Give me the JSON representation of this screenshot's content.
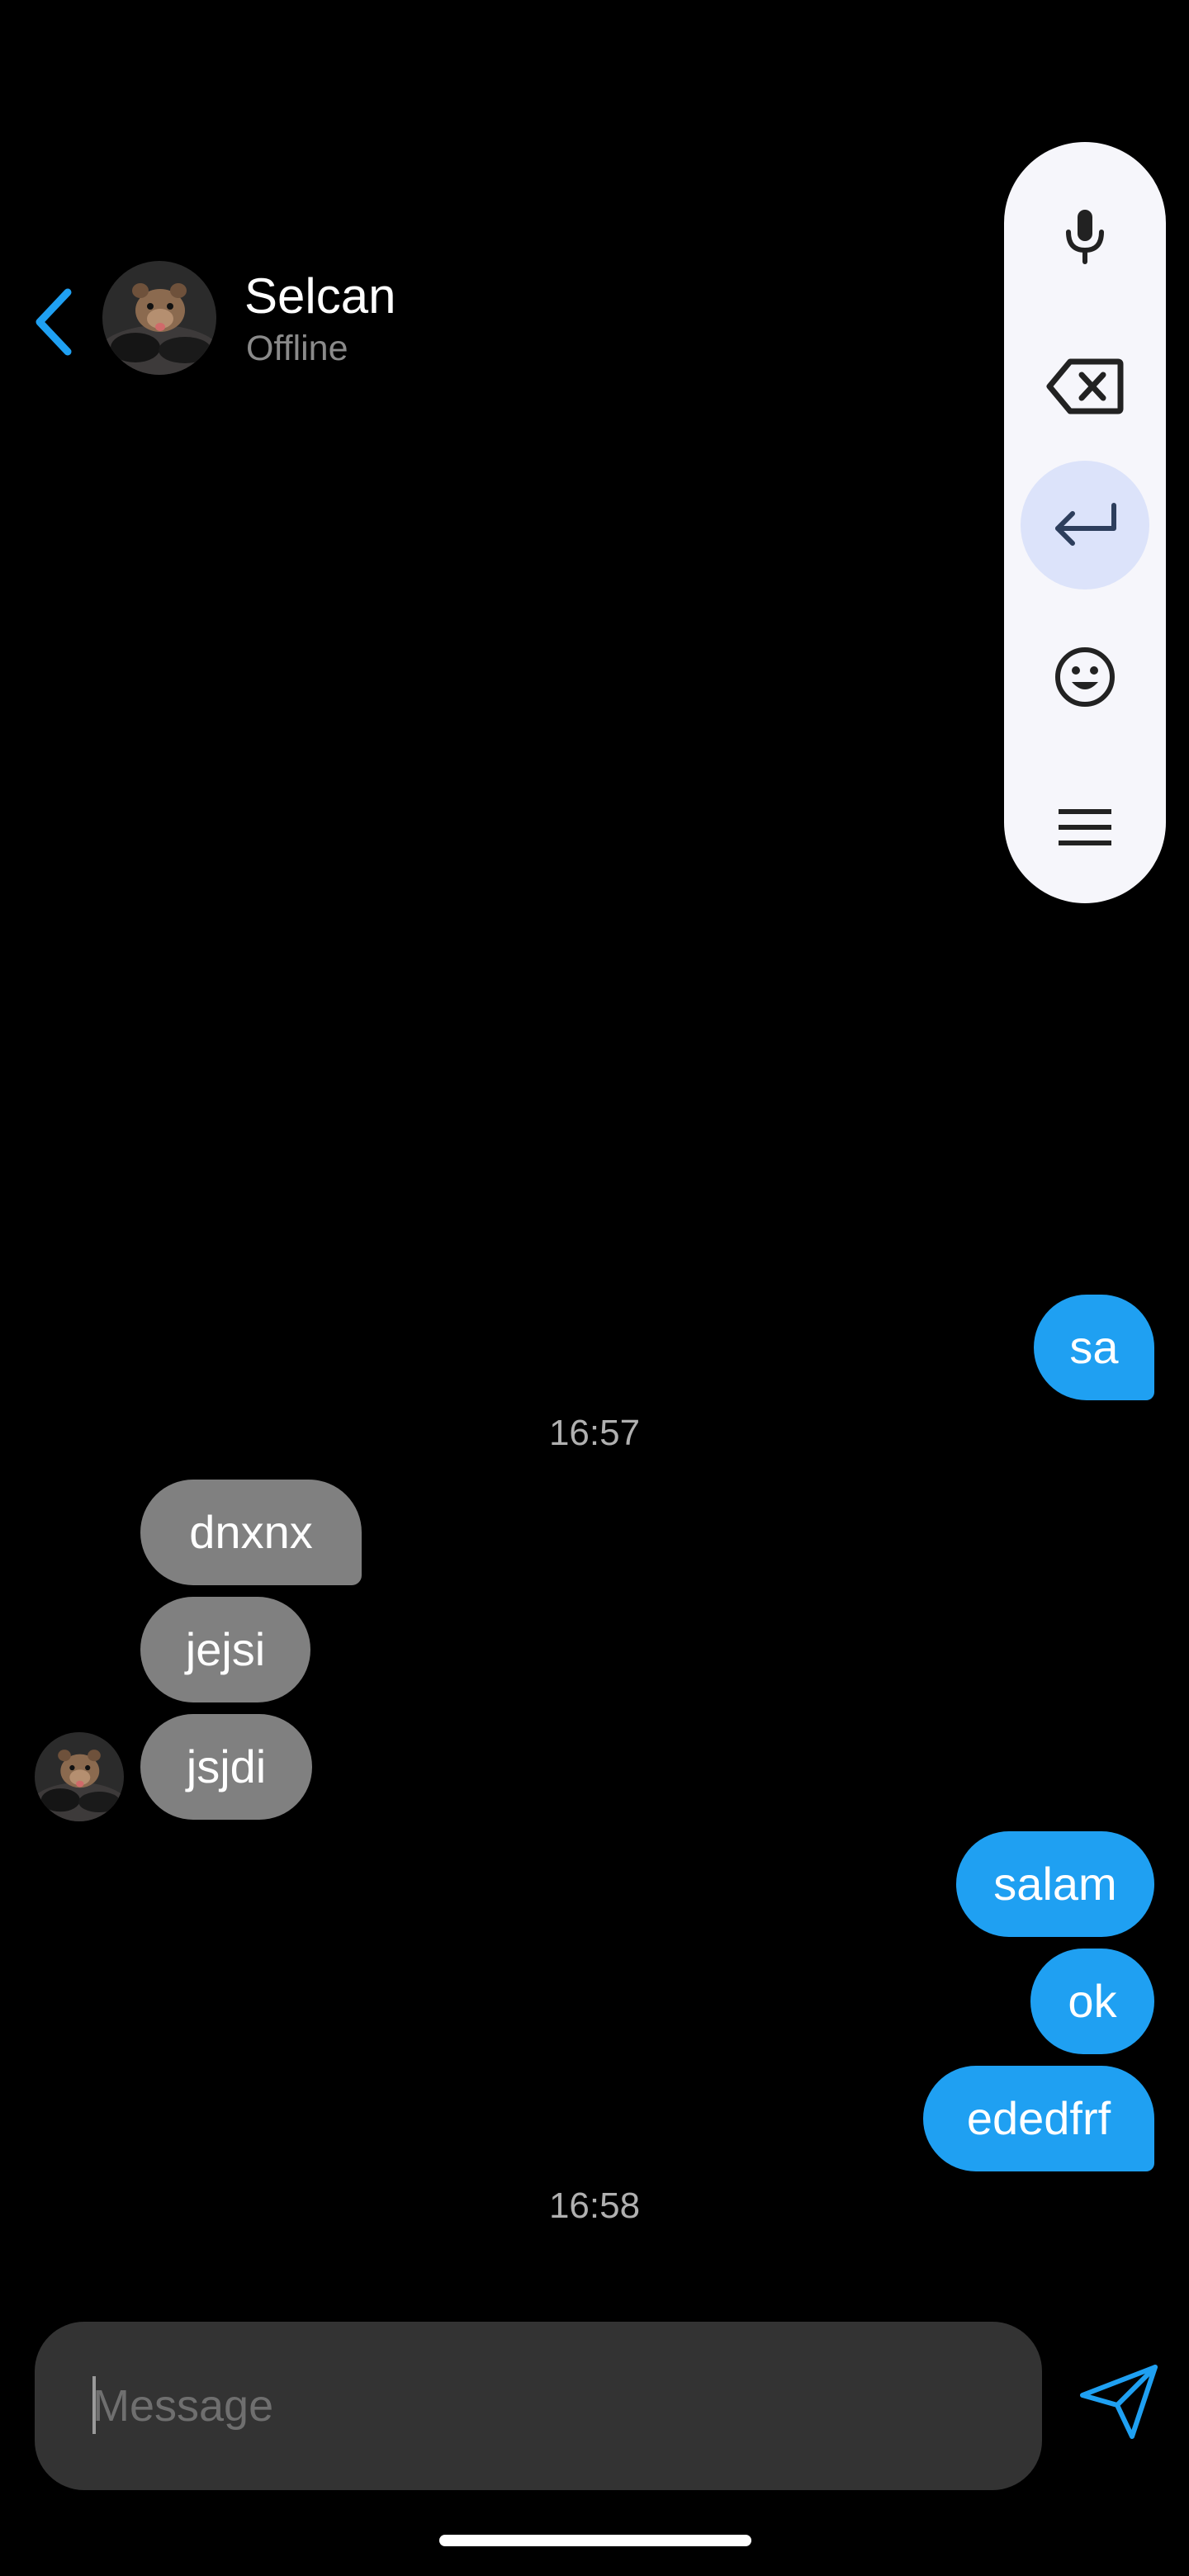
{
  "header": {
    "contact_name": "Selcan",
    "contact_status": "Offline",
    "back_icon": "chevron-left-icon",
    "accent_color": "#1fa0f2"
  },
  "toolbar": {
    "buttons": [
      {
        "icon": "microphone-icon"
      },
      {
        "icon": "backspace-icon"
      },
      {
        "icon": "return-icon",
        "active": true
      },
      {
        "icon": "emoji-icon"
      },
      {
        "icon": "menu-icon"
      }
    ]
  },
  "messages": [
    {
      "direction": "out",
      "text": "sa"
    },
    {
      "type": "timestamp",
      "text": "16:57"
    },
    {
      "direction": "in",
      "text": "dnxnx"
    },
    {
      "direction": "in",
      "text": "jejsi"
    },
    {
      "direction": "in",
      "text": "jsjdi"
    },
    {
      "direction": "out",
      "text": "salam"
    },
    {
      "direction": "out",
      "text": "ok"
    },
    {
      "direction": "out",
      "text": "ededfrf"
    },
    {
      "type": "timestamp",
      "text": "16:58"
    }
  ],
  "composer": {
    "placeholder": "Message",
    "value": "",
    "send_icon": "send-icon"
  },
  "colors": {
    "outgoing_bubble": "#1fa0f2",
    "incoming_bubble": "#808080",
    "background": "#000000",
    "composer_bg": "#333333"
  }
}
